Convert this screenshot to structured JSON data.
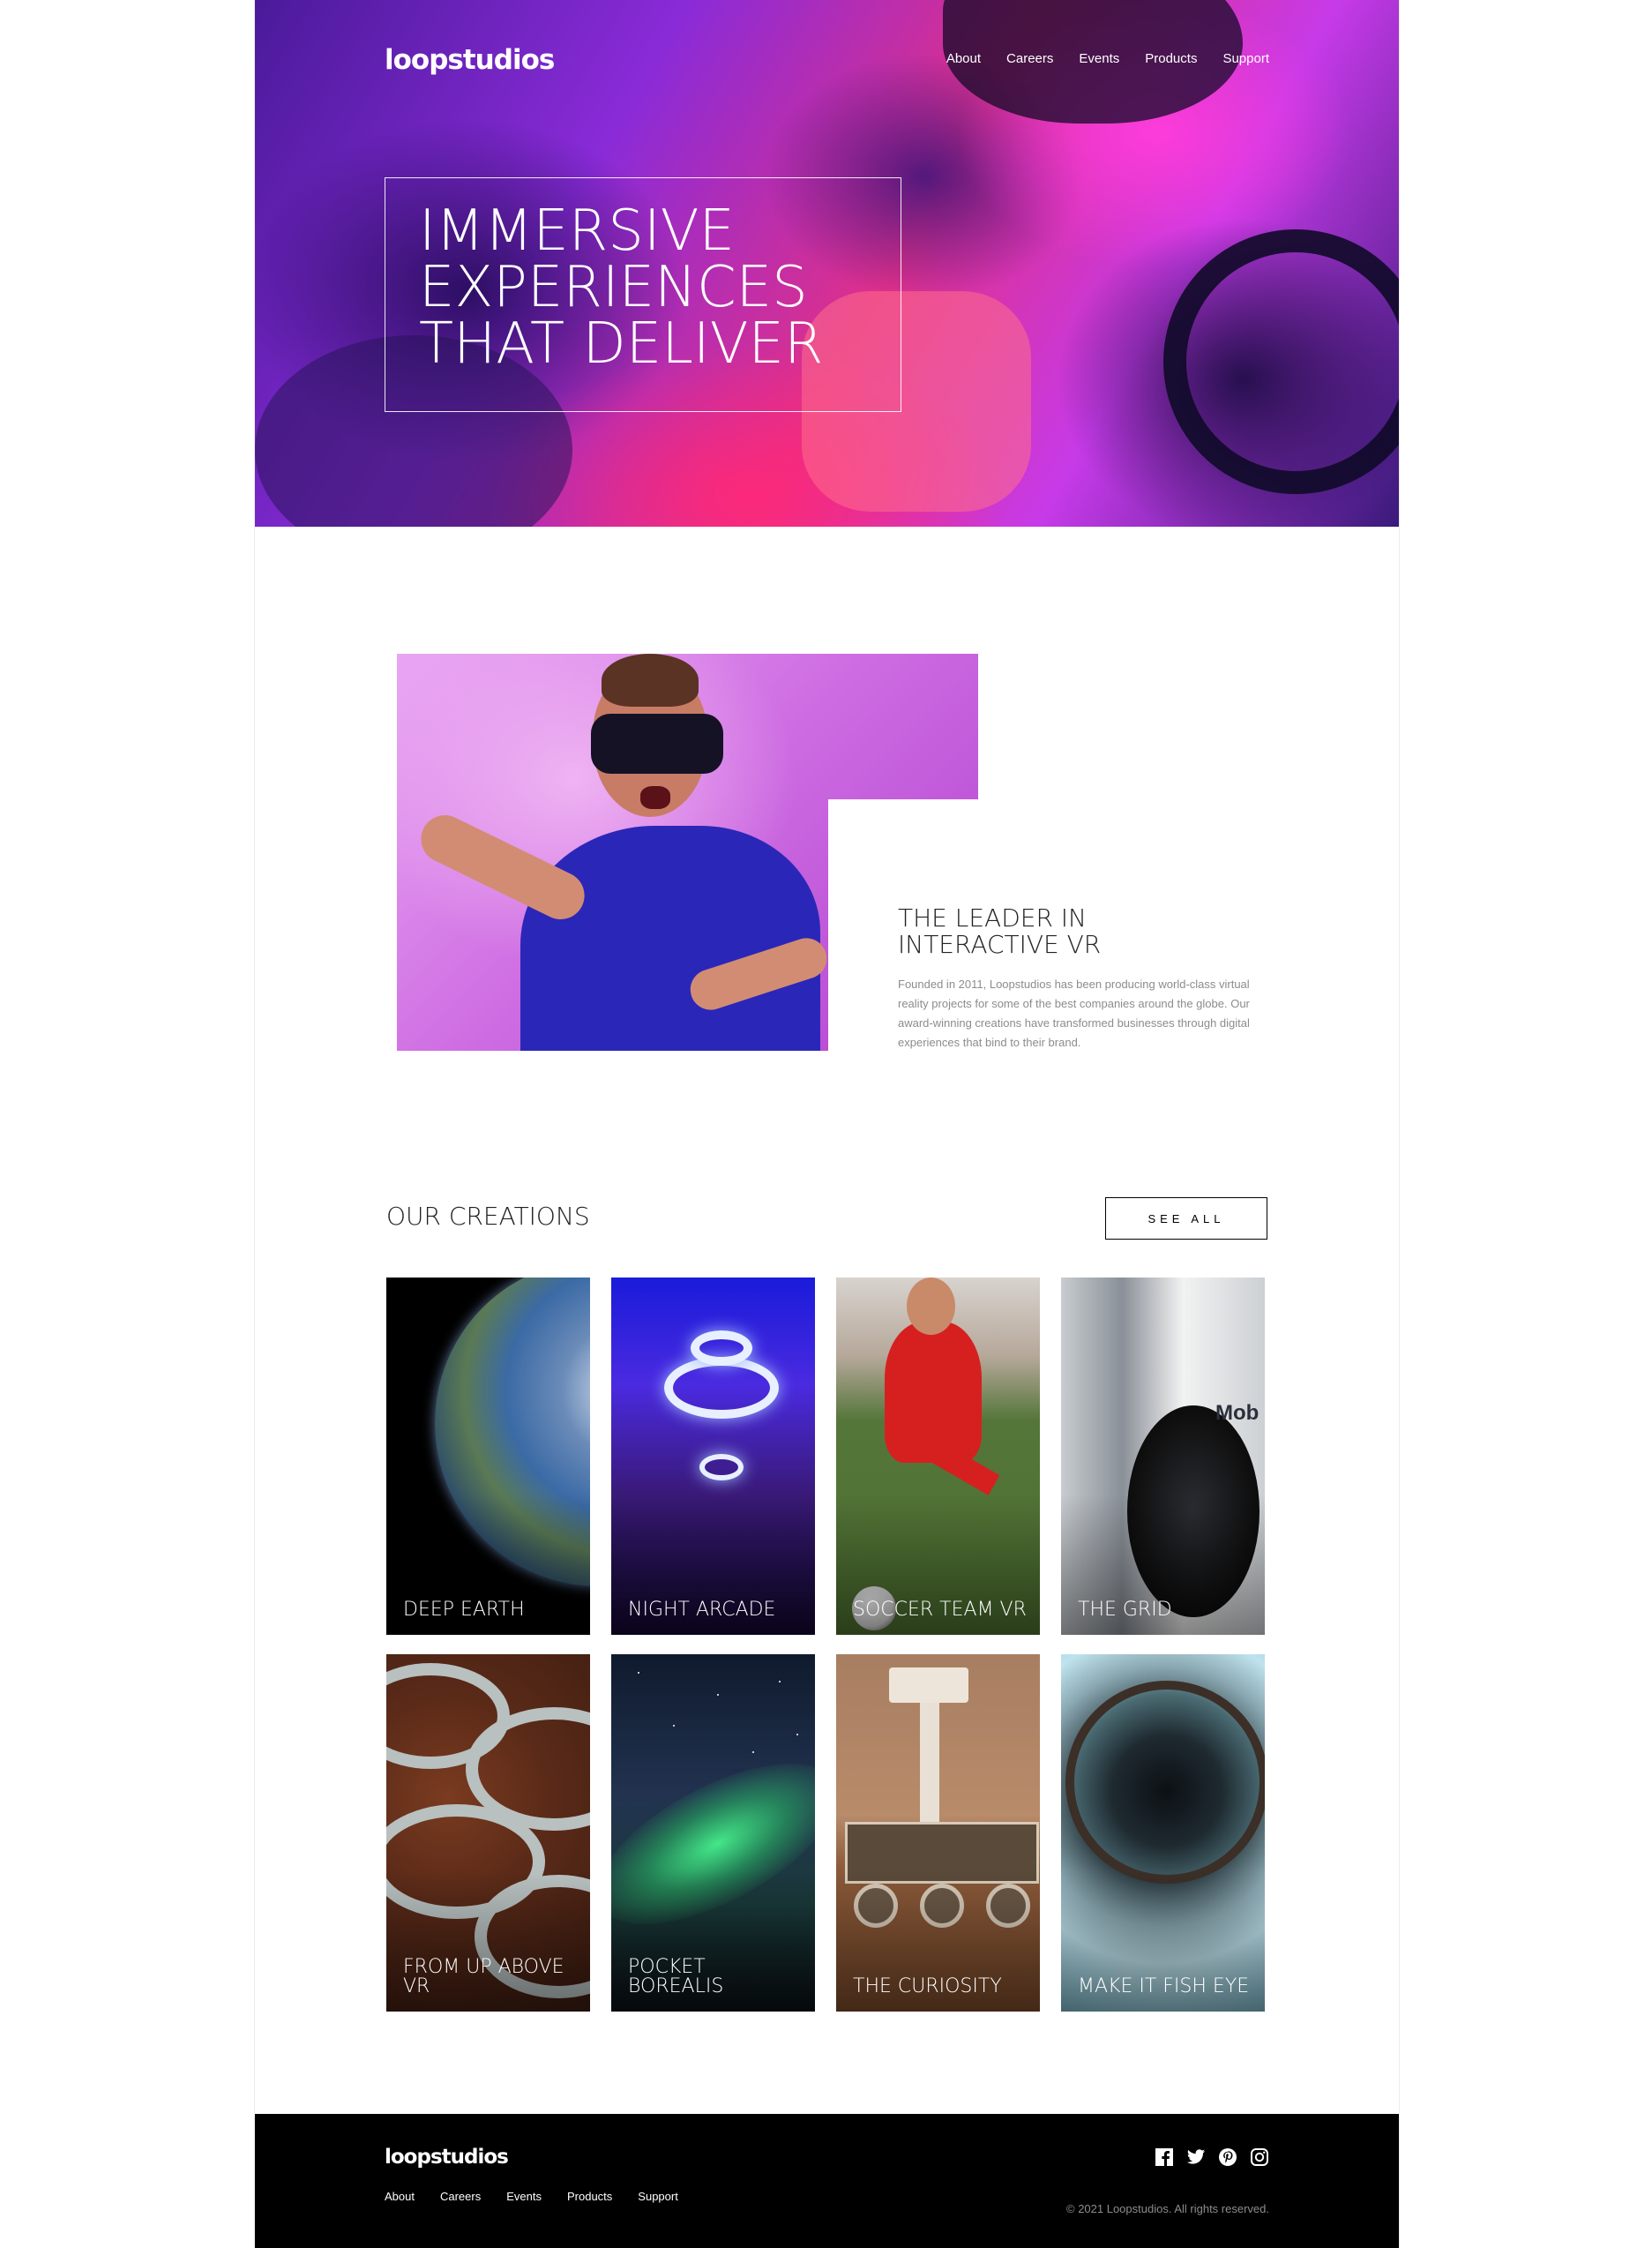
{
  "header": {
    "logo": "loopstudios",
    "nav": [
      "About",
      "Careers",
      "Events",
      "Products",
      "Support"
    ]
  },
  "hero": {
    "title_lines": [
      "IMMERSIVE",
      "EXPERIENCES",
      "THAT DELIVER"
    ]
  },
  "about": {
    "title_lines": [
      "THE LEADER IN",
      "INTERACTIVE VR"
    ],
    "body": "Founded in 2011, Loopstudios has been producing world-class virtual reality projects for some of the best companies around the globe. Our award-winning creations have transformed businesses through digital experiences that bind to their brand."
  },
  "creations": {
    "title": "OUR CREATIONS",
    "see_all": "SEE ALL",
    "items": [
      {
        "label": "DEEP EARTH"
      },
      {
        "label": "NIGHT ARCADE"
      },
      {
        "label": "SOCCER TEAM VR"
      },
      {
        "label": "THE GRID"
      },
      {
        "label": "FROM UP ABOVE VR"
      },
      {
        "label": "POCKET BOREALIS"
      },
      {
        "label": "THE CURIOSITY"
      },
      {
        "label": "MAKE IT FISH EYE"
      }
    ],
    "grid_logo_text": "Mob"
  },
  "footer": {
    "logo": "loopstudios",
    "nav": [
      "About",
      "Careers",
      "Events",
      "Products",
      "Support"
    ],
    "social_icons": [
      "facebook-icon",
      "twitter-icon",
      "pinterest-icon",
      "instagram-icon"
    ],
    "copyright": "© 2021 Loopstudios. All rights reserved."
  },
  "colors": {
    "footer_bg": "#000000",
    "muted_text": "#8c8c8c"
  }
}
